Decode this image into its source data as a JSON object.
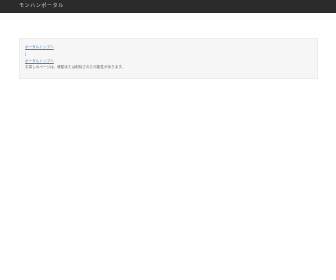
{
  "header": {
    "title": "モンハンポータル"
  },
  "content": {
    "link1": "ポータルトップへ",
    "separator": "|",
    "link2": "ポータルトップへ",
    "description": "お探しのページは、移動または削除された可能性があります。"
  }
}
